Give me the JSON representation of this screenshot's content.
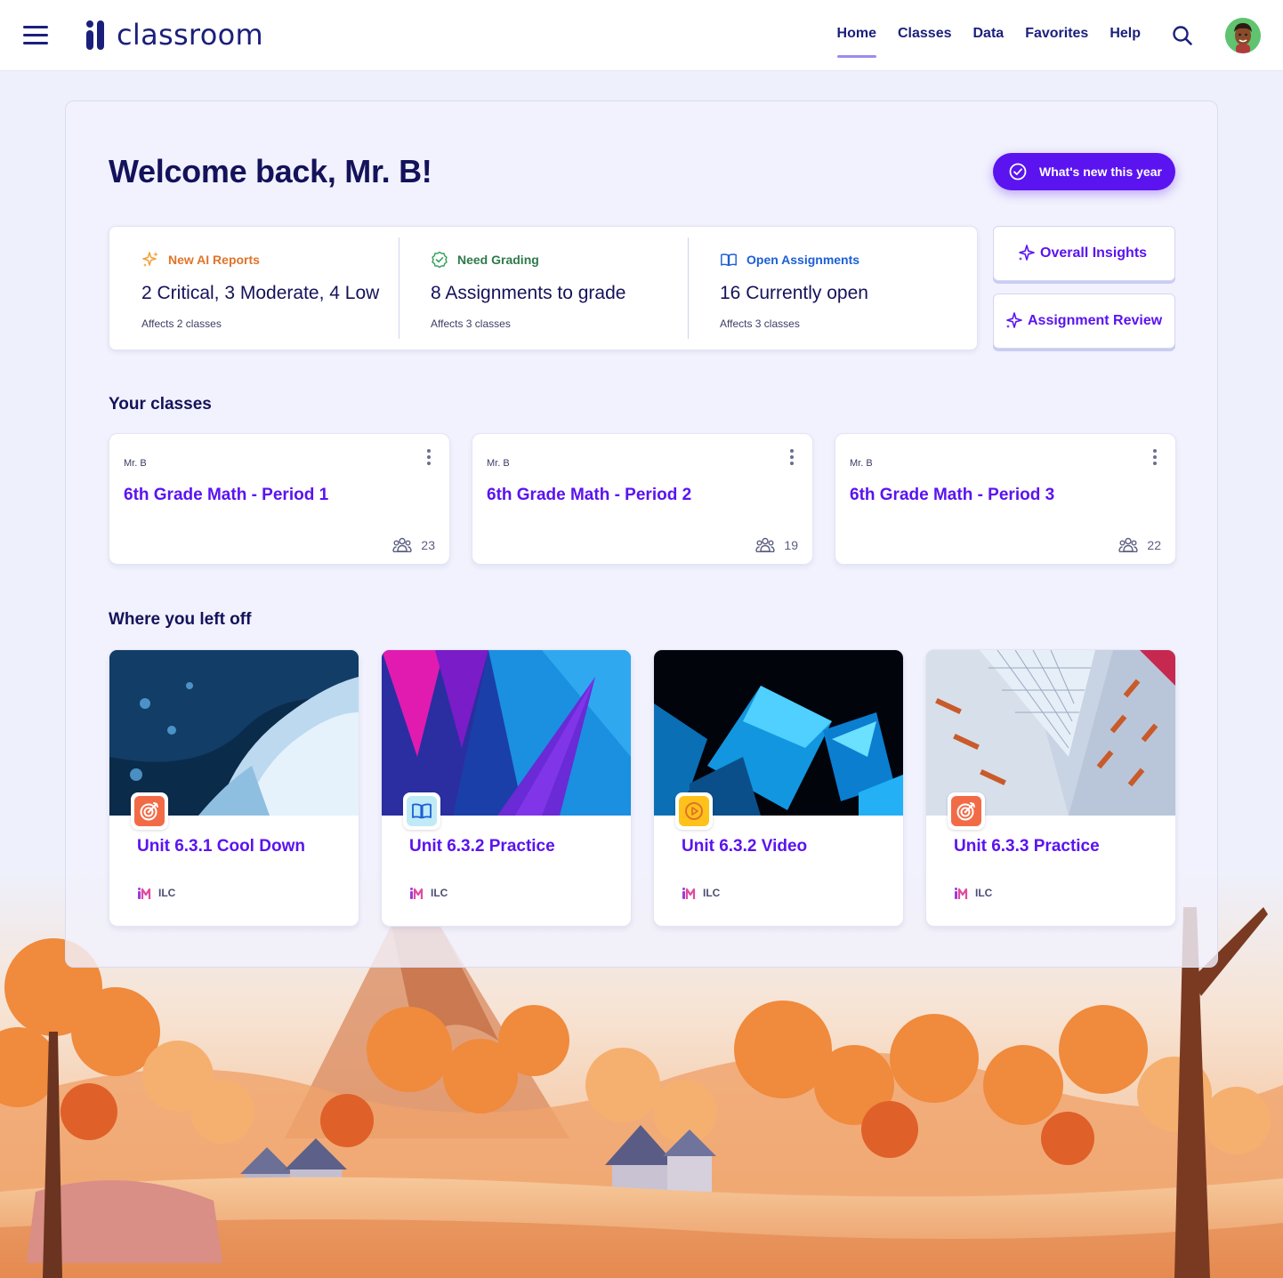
{
  "app": {
    "logo_text": "classroom"
  },
  "nav": {
    "items": [
      {
        "label": "Home",
        "active": true
      },
      {
        "label": "Classes",
        "active": false
      },
      {
        "label": "Data",
        "active": false
      },
      {
        "label": "Favorites",
        "active": false
      },
      {
        "label": "Help",
        "active": false
      }
    ]
  },
  "icons": {
    "menu": "hamburger-menu-icon",
    "search": "search-icon",
    "avatar": "user-avatar"
  },
  "welcome": {
    "title": "Welcome back, Mr. B!",
    "whats_new_label": "What's new this year"
  },
  "stats": [
    {
      "title": "New AI Reports",
      "value": "2 Critical, 3 Moderate, 4 Low",
      "sub": "Affects 2 classes",
      "color": "#e0742a",
      "icon": "sparkle-icon"
    },
    {
      "title": "Need Grading",
      "value": "8 Assignments to grade",
      "sub": "Affects 3 classes",
      "color": "#2f7a4b",
      "icon": "check-badge-icon"
    },
    {
      "title": "Open Assignments",
      "value": "16 Currently open",
      "sub": "Affects 3 classes",
      "color": "#1b5fd6",
      "icon": "book-icon"
    }
  ],
  "side_buttons": {
    "overall_insights": "Overall Insights",
    "assignment_review": "Assignment Review"
  },
  "your_classes": {
    "title": "Your classes",
    "classes": [
      {
        "teacher": "Mr. B",
        "name": "6th Grade Math - Period 1",
        "students": "23"
      },
      {
        "teacher": "Mr. B",
        "name": "6th Grade Math - Period 2",
        "students": "19"
      },
      {
        "teacher": "Mr. B",
        "name": "6th Grade Math - Period 3",
        "students": "22"
      }
    ]
  },
  "where_left_off": {
    "title": "Where you left off",
    "items": [
      {
        "name": "Unit 6.3.1 Cool Down",
        "publisher": "ILC",
        "icon": "target-icon",
        "badge_color": "#f26b47"
      },
      {
        "name": "Unit 6.3.2 Practice",
        "publisher": "ILC",
        "icon": "book-icon",
        "badge_color": "#bfeaf6"
      },
      {
        "name": "Unit 6.3.2 Video",
        "publisher": "ILC",
        "icon": "play-icon",
        "badge_color": "#ffc21a"
      },
      {
        "name": "Unit 6.3.3 Practice",
        "publisher": "ILC",
        "icon": "target-icon",
        "badge_color": "#f26b47"
      }
    ]
  },
  "colors": {
    "brand_navy": "#1b1f7c",
    "accent_purple": "#5b13f0",
    "page_bg": "#eef0fb"
  }
}
